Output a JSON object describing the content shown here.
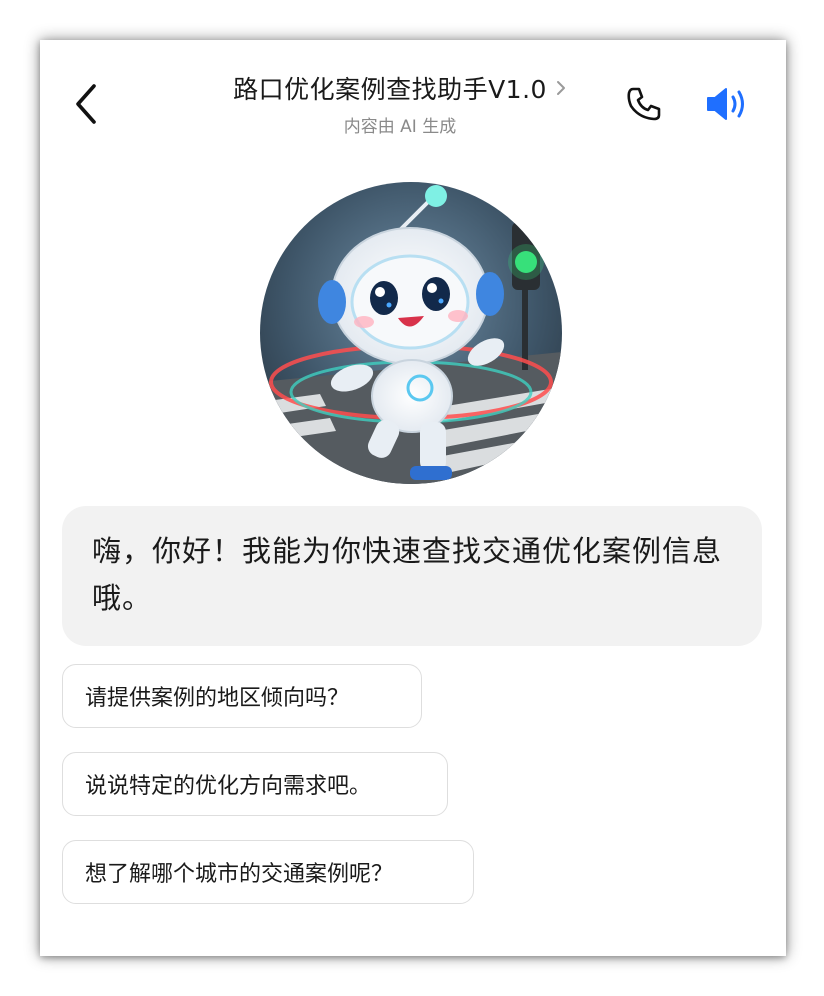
{
  "header": {
    "title": "路口优化案例查找助手V1.0",
    "subtitle": "内容由 AI 生成",
    "back_icon": "chevron-left-icon",
    "title_chevron_icon": "chevron-right-icon",
    "phone_icon": "phone-icon",
    "speaker_icon": "speaker-icon",
    "speaker_color": "#1f6fff"
  },
  "avatar": {
    "icon": "robot-avatar"
  },
  "chat": {
    "greeting": "嗨，你好！我能为你快速查找交通优化案例信息哦。"
  },
  "suggestions": [
    {
      "label": "请提供案例的地区倾向吗？"
    },
    {
      "label": "说说特定的优化方向需求吧。"
    },
    {
      "label": "想了解哪个城市的交通案例呢？"
    }
  ]
}
